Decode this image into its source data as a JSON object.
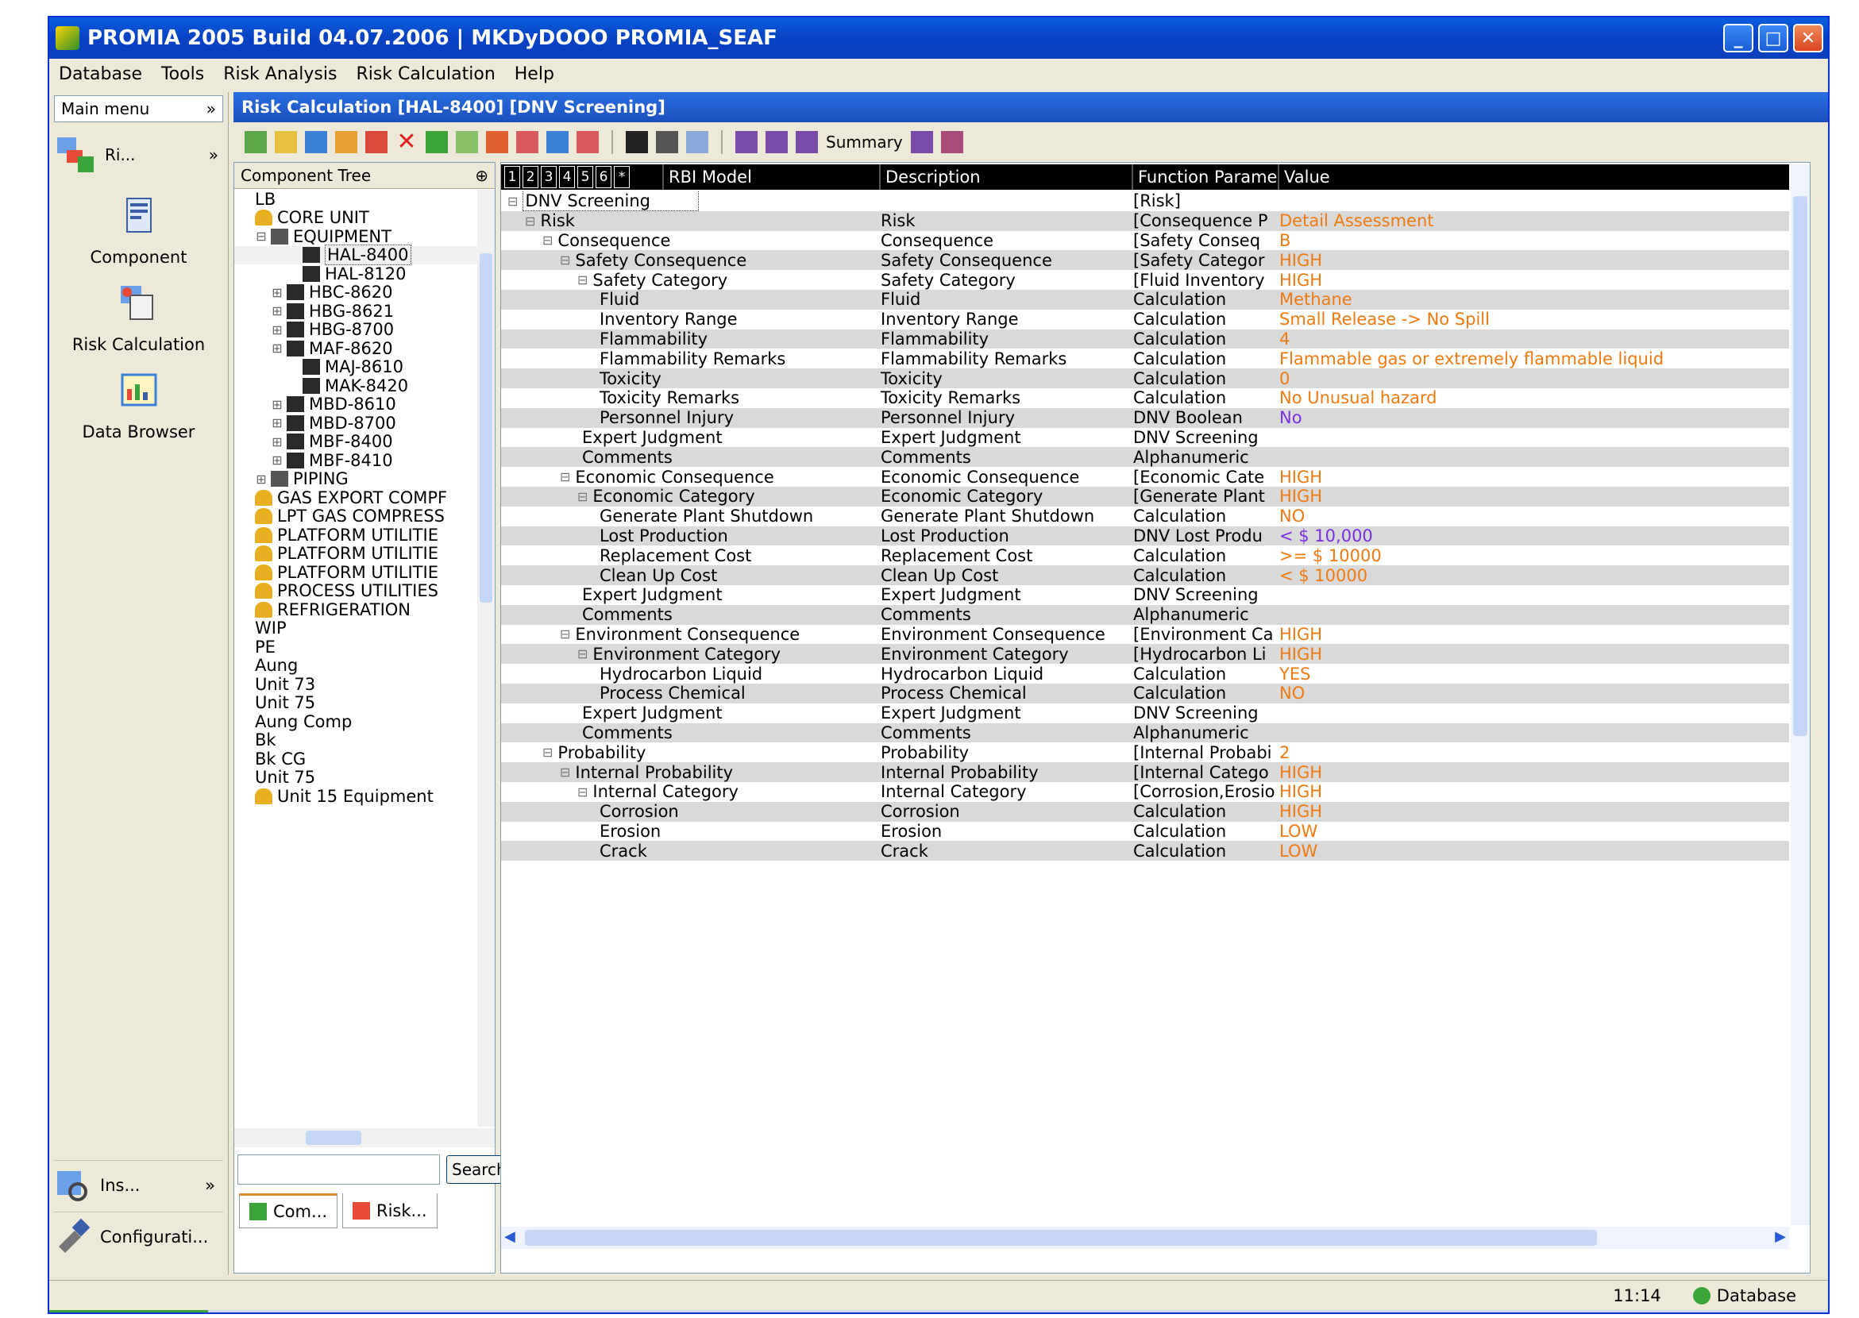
{
  "window": {
    "title": "PROMIA 2005 Build 04.07.2006 | MKDyDOOO PROMIA_SEAF",
    "controls": {
      "minimize": "_",
      "maximize": "□",
      "close": "✕"
    }
  },
  "menu": [
    "Database",
    "Tools",
    "Risk Analysis",
    "Risk Calculation",
    "Help"
  ],
  "nav": {
    "header": "Main menu",
    "header_pin": "»",
    "top_label": "Ri...",
    "top_arrow": "»",
    "items": [
      "Component",
      "Risk Calculation",
      "Data Browser"
    ],
    "bottom_items": [
      {
        "label": "Ins...",
        "arrow": "»"
      },
      {
        "label": "Configurati..."
      }
    ]
  },
  "doc": {
    "title": "Risk Calculation [HAL-8400] [DNV Screening]",
    "toolbar_summary": "Summary"
  },
  "tree": {
    "header": "Component Tree",
    "header_pin": "⊕",
    "rows": [
      {
        "text": "LB",
        "indent": 0,
        "exp": "",
        "icon": "none"
      },
      {
        "text": "CORE UNIT",
        "indent": 0,
        "exp": "",
        "icon": "unit"
      },
      {
        "text": "EQUIPMENT",
        "indent": 1,
        "exp": "⊟",
        "icon": "equip"
      },
      {
        "text": "HAL-8400",
        "indent": 3,
        "exp": "",
        "icon": "item",
        "selected": true
      },
      {
        "text": "HAL-8120",
        "indent": 3,
        "exp": "",
        "icon": "item"
      },
      {
        "text": "HBC-8620",
        "indent": 2,
        "exp": "⊞",
        "icon": "item"
      },
      {
        "text": "HBG-8621",
        "indent": 2,
        "exp": "⊞",
        "icon": "item"
      },
      {
        "text": "HBG-8700",
        "indent": 2,
        "exp": "⊞",
        "icon": "item"
      },
      {
        "text": "MAF-8620",
        "indent": 2,
        "exp": "⊞",
        "icon": "item"
      },
      {
        "text": "MAJ-8610",
        "indent": 3,
        "exp": "",
        "icon": "item"
      },
      {
        "text": "MAK-8420",
        "indent": 3,
        "exp": "",
        "icon": "item"
      },
      {
        "text": "MBD-8610",
        "indent": 2,
        "exp": "⊞",
        "icon": "item"
      },
      {
        "text": "MBD-8700",
        "indent": 2,
        "exp": "⊞",
        "icon": "item"
      },
      {
        "text": "MBF-8400",
        "indent": 2,
        "exp": "⊞",
        "icon": "item"
      },
      {
        "text": "MBF-8410",
        "indent": 2,
        "exp": "⊞",
        "icon": "item"
      },
      {
        "text": "PIPING",
        "indent": 1,
        "exp": "⊞",
        "icon": "equip"
      },
      {
        "text": "GAS EXPORT COMPF",
        "indent": 0,
        "exp": "",
        "icon": "unit"
      },
      {
        "text": "LPT GAS COMPRESS",
        "indent": 0,
        "exp": "",
        "icon": "unit"
      },
      {
        "text": "PLATFORM UTILITIE",
        "indent": 0,
        "exp": "",
        "icon": "unit"
      },
      {
        "text": "PLATFORM UTILITIE",
        "indent": 0,
        "exp": "",
        "icon": "unit"
      },
      {
        "text": "PLATFORM UTILITIE",
        "indent": 0,
        "exp": "",
        "icon": "unit"
      },
      {
        "text": "PROCESS UTILITIES",
        "indent": 0,
        "exp": "",
        "icon": "unit"
      },
      {
        "text": "REFRIGERATION",
        "indent": 0,
        "exp": "",
        "icon": "unit"
      },
      {
        "text": "WIP",
        "indent": 0,
        "exp": "",
        "icon": "none"
      },
      {
        "text": "PE",
        "indent": 0,
        "exp": "",
        "icon": "none"
      },
      {
        "text": "Aung",
        "indent": 0,
        "exp": "",
        "icon": "none"
      },
      {
        "text": "Unit 73",
        "indent": 0,
        "exp": "",
        "icon": "none"
      },
      {
        "text": "Unit 75",
        "indent": 0,
        "exp": "",
        "icon": "none"
      },
      {
        "text": "Aung Comp",
        "indent": 0,
        "exp": "",
        "icon": "none"
      },
      {
        "text": "Bk",
        "indent": 0,
        "exp": "",
        "icon": "none"
      },
      {
        "text": "Bk CG",
        "indent": 0,
        "exp": "",
        "icon": "none"
      },
      {
        "text": "Unit 75",
        "indent": 0,
        "exp": "",
        "icon": "none"
      },
      {
        "text": "Unit 15 Equipment",
        "indent": 0,
        "exp": "",
        "icon": "unit"
      }
    ],
    "search_placeholder": "",
    "search_button": "Search",
    "tabs": [
      "Com...",
      "Risk..."
    ]
  },
  "grid": {
    "level_buttons": [
      "1",
      "2",
      "3",
      "4",
      "5",
      "6",
      "*"
    ],
    "columns": [
      "RBI Model",
      "Description",
      "Function Parame",
      "Value"
    ],
    "rows": [
      {
        "model": "DNV Screening",
        "indent": 0,
        "exp": "⊟",
        "desc": "",
        "func": "[Risk]",
        "value": "",
        "vc": ""
      },
      {
        "model": "Risk",
        "indent": 1,
        "exp": "⊟",
        "desc": "Risk",
        "func": "[Consequence P",
        "value": "Detail Assessment",
        "vc": "orange"
      },
      {
        "model": "Consequence",
        "indent": 2,
        "exp": "⊟",
        "desc": "Consequence",
        "func": "[Safety Conseq",
        "value": "B",
        "vc": "orange"
      },
      {
        "model": "Safety Consequence",
        "indent": 3,
        "exp": "⊟",
        "desc": "Safety Consequence",
        "func": "[Safety Categor",
        "value": "HIGH",
        "vc": "orange"
      },
      {
        "model": "Safety Category",
        "indent": 4,
        "exp": "⊟",
        "desc": "Safety Category",
        "func": "[Fluid Inventory",
        "value": "HIGH",
        "vc": "orange"
      },
      {
        "model": "Fluid",
        "indent": 5,
        "exp": "",
        "desc": "Fluid",
        "func": "Calculation",
        "value": "Methane",
        "vc": "orange"
      },
      {
        "model": "Inventory Range",
        "indent": 5,
        "exp": "",
        "desc": "Inventory Range",
        "func": "Calculation",
        "value": "Small Release -> No Spill",
        "vc": "orange"
      },
      {
        "model": "Flammability",
        "indent": 5,
        "exp": "",
        "desc": "Flammability",
        "func": "Calculation",
        "value": "4",
        "vc": "orange"
      },
      {
        "model": "Flammability Remarks",
        "indent": 5,
        "exp": "",
        "desc": "Flammability Remarks",
        "func": "Calculation",
        "value": "Flammable gas or extremely flammable liquid",
        "vc": "orange"
      },
      {
        "model": "Toxicity",
        "indent": 5,
        "exp": "",
        "desc": "Toxicity",
        "func": "Calculation",
        "value": "0",
        "vc": "orange"
      },
      {
        "model": "Toxicity Remarks",
        "indent": 5,
        "exp": "",
        "desc": "Toxicity Remarks",
        "func": "Calculation",
        "value": "No Unusual hazard",
        "vc": "orange"
      },
      {
        "model": "Personnel Injury",
        "indent": 5,
        "exp": "",
        "desc": "Personnel Injury",
        "func": "DNV Boolean",
        "value": "No",
        "vc": "purple"
      },
      {
        "model": "Expert Judgment",
        "indent": 4,
        "exp": "",
        "desc": "Expert Judgment",
        "func": "DNV Screening",
        "value": "",
        "vc": ""
      },
      {
        "model": "Comments",
        "indent": 4,
        "exp": "",
        "desc": "Comments",
        "func": "Alphanumeric",
        "value": "",
        "vc": ""
      },
      {
        "model": "Economic Consequence",
        "indent": 3,
        "exp": "⊟",
        "desc": "Economic Consequence",
        "func": "[Economic Cate",
        "value": "HIGH",
        "vc": "orange"
      },
      {
        "model": "Economic Category",
        "indent": 4,
        "exp": "⊟",
        "desc": "Economic Category",
        "func": "[Generate Plant",
        "value": "HIGH",
        "vc": "orange"
      },
      {
        "model": "Generate Plant Shutdown",
        "indent": 5,
        "exp": "",
        "desc": "Generate Plant Shutdown",
        "func": "Calculation",
        "value": "NO",
        "vc": "orange"
      },
      {
        "model": "Lost Production",
        "indent": 5,
        "exp": "",
        "desc": "Lost Production",
        "func": "DNV Lost Produ",
        "value": "< $ 10,000",
        "vc": "purple"
      },
      {
        "model": "Replacement Cost",
        "indent": 5,
        "exp": "",
        "desc": "Replacement Cost",
        "func": "Calculation",
        "value": ">= $ 10000",
        "vc": "orange"
      },
      {
        "model": "Clean Up Cost",
        "indent": 5,
        "exp": "",
        "desc": "Clean Up Cost",
        "func": "Calculation",
        "value": "< $ 10000",
        "vc": "orange"
      },
      {
        "model": "Expert Judgment",
        "indent": 4,
        "exp": "",
        "desc": "Expert Judgment",
        "func": "DNV Screening",
        "value": "",
        "vc": ""
      },
      {
        "model": "Comments",
        "indent": 4,
        "exp": "",
        "desc": "Comments",
        "func": "Alphanumeric",
        "value": "",
        "vc": ""
      },
      {
        "model": "Environment Consequence",
        "indent": 3,
        "exp": "⊟",
        "desc": "Environment Consequence",
        "func": "[Environment Ca",
        "value": "HIGH",
        "vc": "orange"
      },
      {
        "model": "Environment Category",
        "indent": 4,
        "exp": "⊟",
        "desc": "Environment Category",
        "func": "[Hydrocarbon Li",
        "value": "HIGH",
        "vc": "orange"
      },
      {
        "model": "Hydrocarbon Liquid",
        "indent": 5,
        "exp": "",
        "desc": "Hydrocarbon Liquid",
        "func": "Calculation",
        "value": "YES",
        "vc": "orange"
      },
      {
        "model": "Process Chemical",
        "indent": 5,
        "exp": "",
        "desc": "Process Chemical",
        "func": "Calculation",
        "value": "NO",
        "vc": "orange"
      },
      {
        "model": "Expert Judgment",
        "indent": 4,
        "exp": "",
        "desc": "Expert Judgment",
        "func": "DNV Screening",
        "value": "",
        "vc": ""
      },
      {
        "model": "Comments",
        "indent": 4,
        "exp": "",
        "desc": "Comments",
        "func": "Alphanumeric",
        "value": "",
        "vc": ""
      },
      {
        "model": "Probability",
        "indent": 2,
        "exp": "⊟",
        "desc": "Probability",
        "func": "[Internal Probabi",
        "value": "2",
        "vc": "orange"
      },
      {
        "model": "Internal Probability",
        "indent": 3,
        "exp": "⊟",
        "desc": "Internal Probability",
        "func": "[Internal Catego",
        "value": "HIGH",
        "vc": "orange"
      },
      {
        "model": "Internal Category",
        "indent": 4,
        "exp": "⊟",
        "desc": "Internal Category",
        "func": "[Corrosion,Erosio",
        "value": "HIGH",
        "vc": "orange"
      },
      {
        "model": "Corrosion",
        "indent": 5,
        "exp": "",
        "desc": "Corrosion",
        "func": "Calculation",
        "value": "HIGH",
        "vc": "orange"
      },
      {
        "model": "Erosion",
        "indent": 5,
        "exp": "",
        "desc": "Erosion",
        "func": "Calculation",
        "value": "LOW",
        "vc": "orange"
      },
      {
        "model": "Crack",
        "indent": 5,
        "exp": "",
        "desc": "Crack",
        "func": "Calculation",
        "value": "LOW",
        "vc": "orange"
      }
    ]
  },
  "status": {
    "time": "11:14",
    "database": "Database"
  },
  "colors": {
    "orange": "#f07a10",
    "purple": "#7a30e0",
    "titlebar": "#0843c5",
    "accent": "#2a6fe0"
  }
}
